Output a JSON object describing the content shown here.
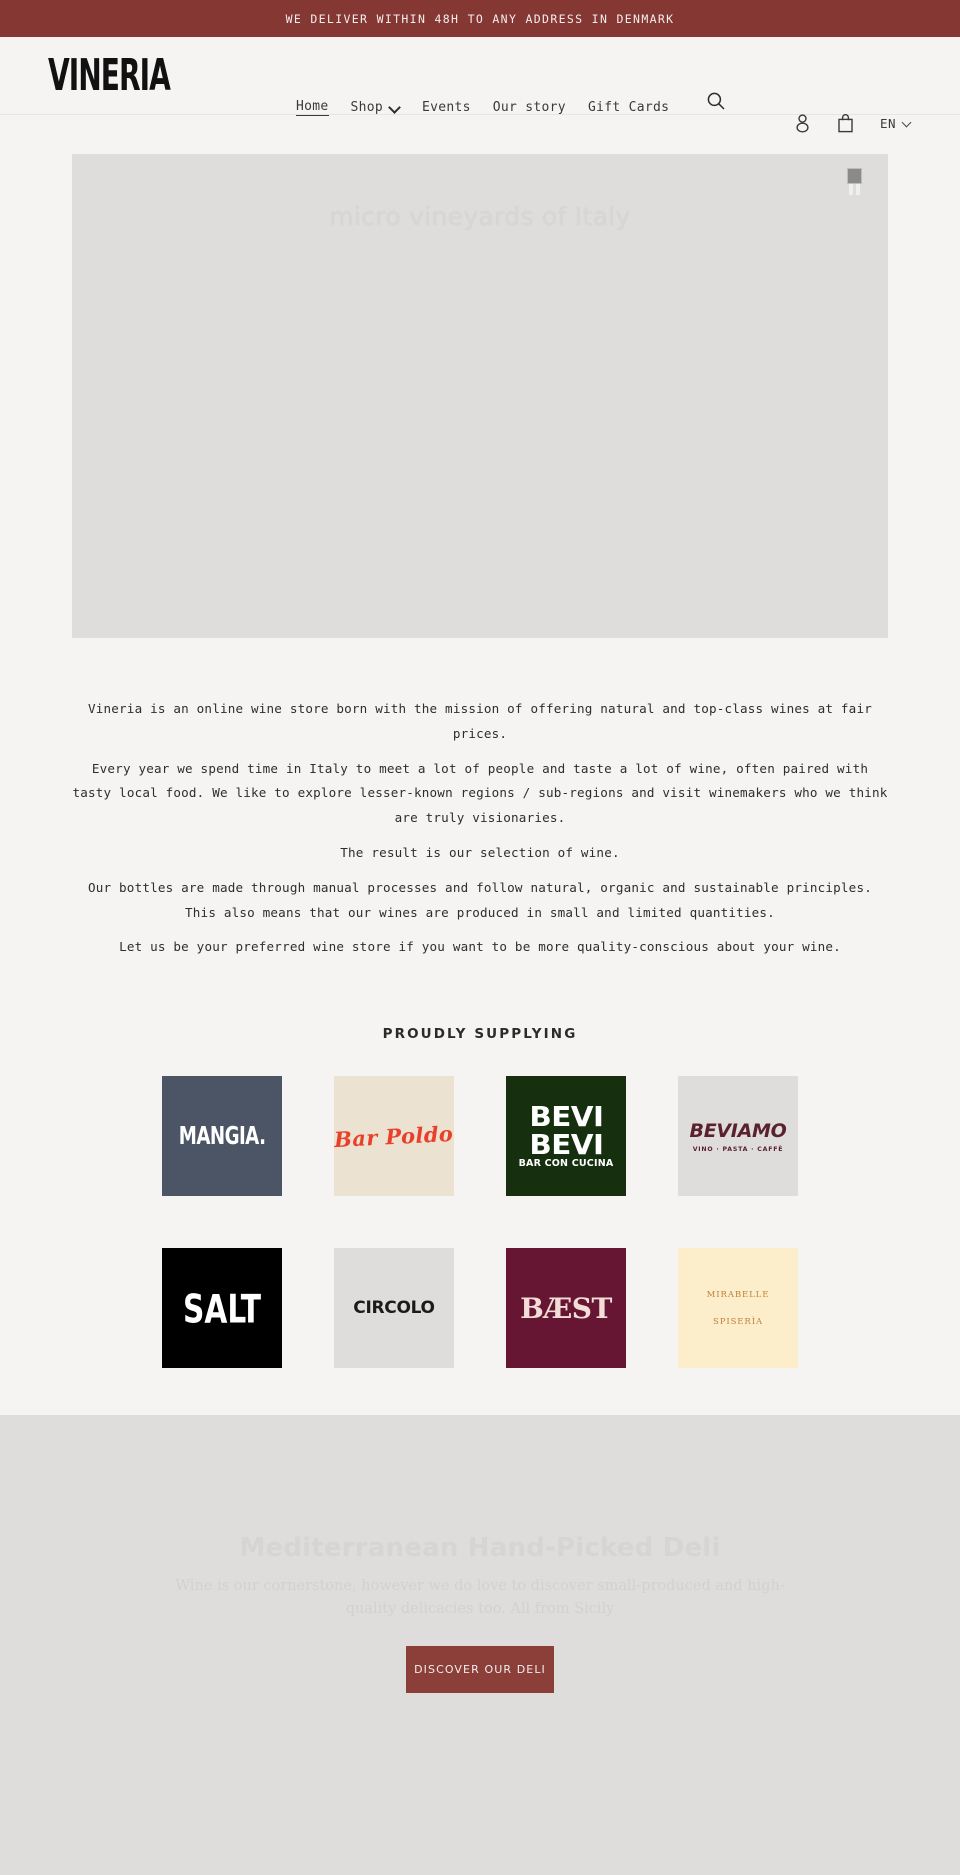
{
  "announcement": {
    "text": "WE DELIVER WITHIN 48H TO ANY ADDRESS IN DENMARK",
    "background": "#853733"
  },
  "header": {
    "logo": "VINERIA",
    "nav": [
      {
        "label": "Home",
        "active": true
      },
      {
        "label": "Shop",
        "has_dropdown": true
      },
      {
        "label": "Events"
      },
      {
        "label": "Our story"
      },
      {
        "label": "Gift Cards"
      }
    ],
    "search_icon": "search-icon",
    "account_icon": "account-icon",
    "cart_icon": "cart-icon",
    "language": "EN"
  },
  "hero": {
    "title": "micro vineyards of Italy",
    "pause_control": "pause-icon",
    "background": "#dedddb"
  },
  "intro": {
    "paragraphs": [
      "Vineria is an online wine store born with the mission of offering natural and top-class wines at fair prices.",
      "Every year we spend time in Italy to meet a lot of people and taste a lot of wine, often paired with tasty local food. We like to explore lesser-known regions / sub-regions and visit winemakers who we think are truly visionaries.",
      "The result is our selection of wine.",
      "Our bottles are made through manual processes and follow natural, organic and sustainable principles. This also means that our wines are produced in small and limited quantities.",
      "Let us be your preferred wine store if you want to be more quality-conscious about your wine."
    ]
  },
  "supplying": {
    "heading": "PROUDLY SUPPLYING",
    "brands": [
      {
        "name": "MANGIA.",
        "bg": "#4c5566",
        "fg": "#ffffff"
      },
      {
        "name": "Bar Poldo",
        "bg": "#ece2d2",
        "fg": "#e8402a"
      },
      {
        "name": "BEVI BEVI",
        "tagline": "BAR CON CUCINA",
        "bg": "#16300f",
        "fg": "#ffffff"
      },
      {
        "name": "BEVIAMO",
        "tagline": "VINO · PASTA · CAFFÈ",
        "bg": "#dedddb",
        "fg": "#5a2230"
      },
      {
        "name": "SALT",
        "bg": "#000000",
        "fg": "#ffffff"
      },
      {
        "name": "CIRCOLO",
        "bg": "#dedddb",
        "fg": "#1b1b1b"
      },
      {
        "name": "BÆST",
        "bg": "#661632",
        "fg": "#f2ddd8"
      },
      {
        "name": "MIRABELLE",
        "tagline": "SPISERÌA",
        "bg": "#fdeecb",
        "fg": "#c0813d"
      }
    ]
  },
  "deli": {
    "title": "Mediterranean Hand-Picked Deli",
    "subtitle": "Wine is our cornerstone, however we do love to discover small-produced and high-quality delicacies too. All from Sicily",
    "button": "DISCOVER OUR DELI",
    "button_color": "#8c3e39",
    "background": "#dedddb"
  }
}
